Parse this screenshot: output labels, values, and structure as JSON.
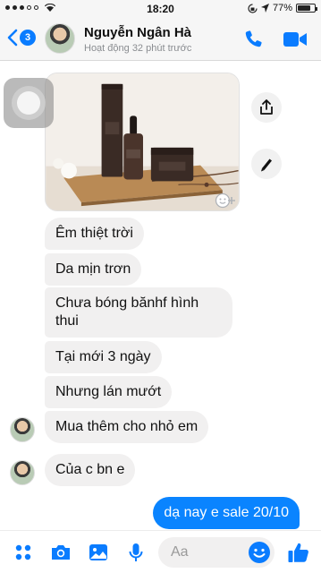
{
  "status_bar": {
    "time": "18:20",
    "battery_percent": "77%",
    "battery_level": 0.77,
    "icons": [
      "signal-dots-icon",
      "wifi-icon",
      "lock-rotation-icon",
      "location-icon",
      "battery-icon"
    ]
  },
  "header": {
    "unread_count": "3",
    "contact_name": "Nguyễn Ngân Hà",
    "contact_status": "Hoạt động 32 phút trước",
    "icons": [
      "back-chevron-icon",
      "phone-icon",
      "video-camera-icon"
    ]
  },
  "messages": [
    {
      "text": "Êm thiệt trời",
      "direction": "received"
    },
    {
      "text": "Da mịn trơn",
      "direction": "received"
    },
    {
      "text": "Chưa bóng bănhf hình thui",
      "direction": "received"
    },
    {
      "text": "Tại mới 3 ngày",
      "direction": "received"
    },
    {
      "text": "Nhưng lán mướt",
      "direction": "received"
    },
    {
      "text": "Mua thêm cho nhỏ em",
      "direction": "received"
    },
    {
      "text": "Của c bn e",
      "direction": "received"
    },
    {
      "text": "dạ nay e sale 20/10",
      "direction": "sent"
    }
  ],
  "side_actions": [
    "share-icon",
    "edit-pencil-icon"
  ],
  "composer": {
    "placeholder": "Aa",
    "icons": [
      "more-dots-icon",
      "camera-icon",
      "gallery-icon",
      "microphone-icon",
      "emoji-icon",
      "like-thumb-icon"
    ]
  },
  "colors": {
    "accent": "#0a84ff",
    "received_bubble": "#f1f0f0",
    "header_bg": "#f6f6f6"
  }
}
